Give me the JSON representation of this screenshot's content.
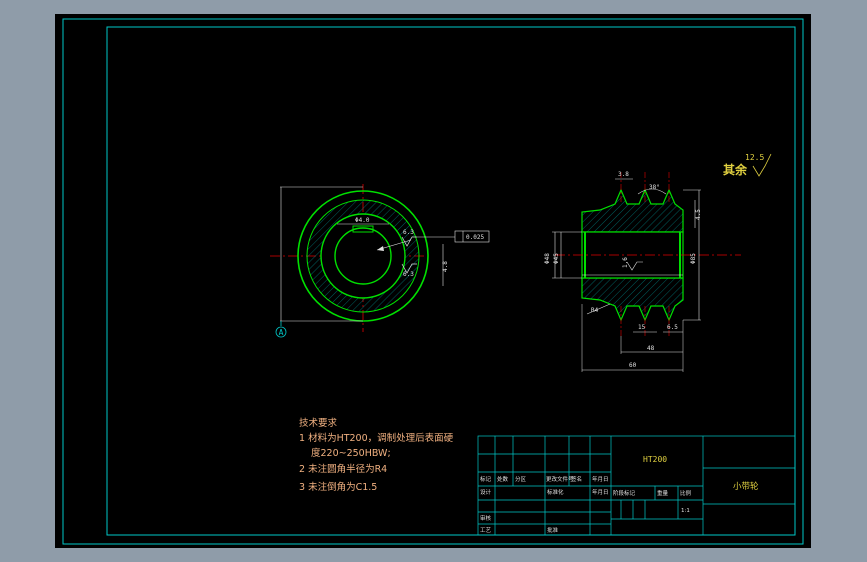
{
  "tech_requirements": {
    "heading": "技术要求",
    "lines": [
      "1 材料为HT200，调制处理后表面硬",
      "度220~250HBW;",
      "2 未注圆角半径为R4",
      "3 未注倒角为C1.5"
    ]
  },
  "surface_note": {
    "label": "其余",
    "value": "12.5"
  },
  "datum_label": "A",
  "title_block": {
    "material": "HT200",
    "part_name": "小带轮",
    "scale": "1:1",
    "cells": {
      "mark": "标记",
      "count": "处数",
      "zone": "分区",
      "change_doc": "更改文件号",
      "signature": "签名",
      "date": "年月日",
      "designer": "设计",
      "standardization": "标准化",
      "stage_mark": "阶段标记",
      "weight": "重量",
      "ratio": "比例",
      "reviewer": "审核",
      "process": "工艺",
      "approve": "批准"
    }
  },
  "front_view": {
    "bore_dim": "Φ4.0",
    "roughness_1": "6.3",
    "roughness_2": "6.3",
    "tolerance_frame": "0.025",
    "side_dim": "4.8"
  },
  "section_view": {
    "dim_top": "3.8",
    "dim_angle": "38°",
    "dim_right": "4.5",
    "dim_left_1": "Φ48",
    "dim_left_2": "Φ45",
    "dim_od": "Φ85",
    "dim_inner": "1.6",
    "dim_pitch": "15",
    "dim_end": "6.5",
    "dim_groove": "48",
    "dim_length": "60",
    "dim_fillet": "R4"
  },
  "colors": {
    "frame": "#00c8c8",
    "outline": "#00e000",
    "center": "#e00000",
    "dim": "#e0e0e0",
    "text": "#f0b080",
    "title": "#e0d040"
  }
}
